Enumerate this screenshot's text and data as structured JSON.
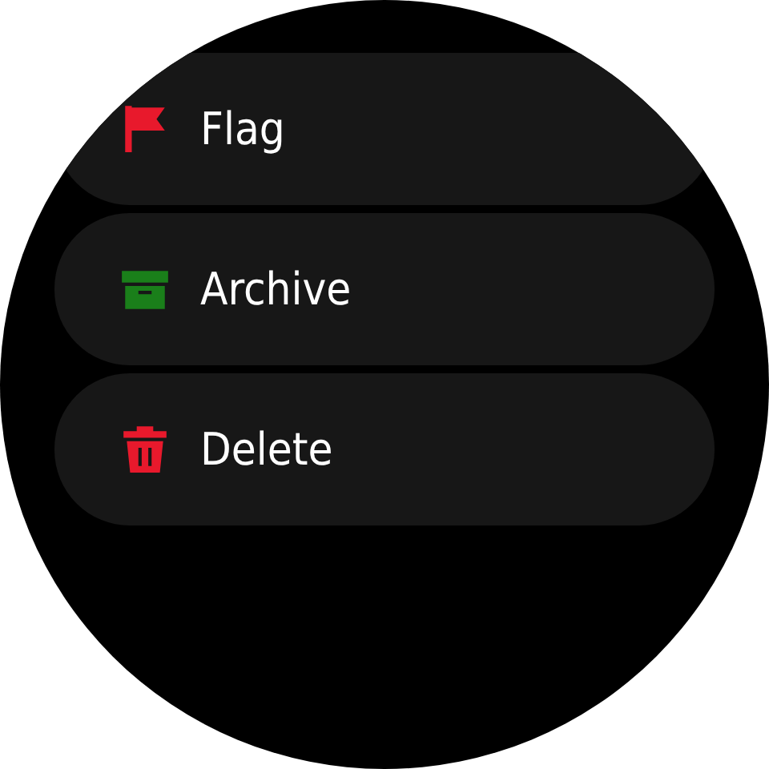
{
  "actions": [
    {
      "label": "Flag",
      "kind": "flag",
      "color": "#e8192c"
    },
    {
      "label": "Archive",
      "kind": "archive",
      "color": "#1a7f1a"
    },
    {
      "label": "Delete",
      "kind": "delete",
      "color": "#e8192c"
    }
  ]
}
